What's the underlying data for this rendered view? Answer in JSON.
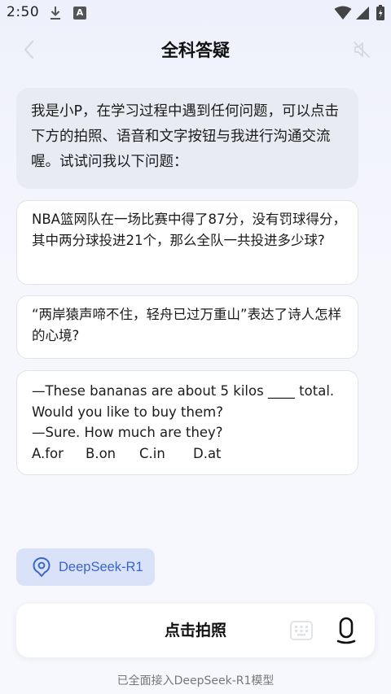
{
  "status_bar": {
    "time": "2:50",
    "a_badge": "A",
    "icons": [
      "download-icon",
      "a-badge-icon",
      "wifi-icon",
      "signal-icon",
      "battery-icon"
    ]
  },
  "header": {
    "title": "全科答疑",
    "back_icon": "back-arrow-icon",
    "mute_icon": "speaker-mute-icon"
  },
  "greeting": {
    "text": "我是小P，在学习过程中遇到任何问题，可以点击下方的拍照、语音和文字按钮与我进行沟通交流喔。试试问我以下问题："
  },
  "questions": [
    {
      "text": "NBA篮网队在一场比赛中得了87分，没有罚球得分，其中两分球投进21个，那么全队一共投进多少球?"
    },
    {
      "text": "“两岸猿声啼不住，轻舟已过万重山”表达了诗人怎样的心境?"
    },
    {
      "lines": [
        "—These bananas are about 5 kilos ____ total.",
        "Would you like to buy them?",
        "—Sure. How much are they?"
      ],
      "options": [
        "A.for",
        "B.on",
        "C.in",
        "D.at"
      ]
    }
  ],
  "model_chip": {
    "label": "DeepSeek-R1",
    "icon": "location-pin-icon"
  },
  "input_bar": {
    "photo_label": "点击拍照",
    "keyboard_icon": "keyboard-icon",
    "mic_icon": "microphone-icon"
  },
  "footer": {
    "note": "已全面接入DeepSeek-R1模型"
  },
  "colors": {
    "accent": "#3a66c9",
    "chip_bg": "#d9e2f8",
    "bubble_bg": "#e9ebf2"
  }
}
